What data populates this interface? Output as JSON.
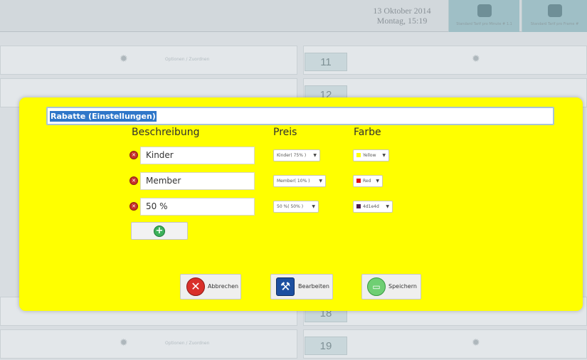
{
  "background": {
    "date": "13 Oktober 2014",
    "weekday_time": "Montag, 15:19",
    "tile_labels": [
      "Standard Tarif pro Minute # 1.1",
      "Standard Tarif pro Frame #"
    ],
    "rows": [
      {
        "option_label": "Optionen / Zuordnen",
        "right_number": "11"
      },
      {
        "option_label": "",
        "right_number": "12"
      },
      {
        "option_label": "",
        "right_number": "18"
      },
      {
        "option_label": "Optionen / Zuordnen",
        "right_number": "19"
      }
    ]
  },
  "dialog": {
    "title": "Rabatte (Einstellungen)",
    "headers": {
      "description": "Beschreibung",
      "price": "Preis",
      "color": "Farbe"
    },
    "items": [
      {
        "description": "Kinder",
        "price": "Kinder( 75% )",
        "color_name": "Yellow",
        "color_hex": "#ffff00"
      },
      {
        "description": "Member",
        "price": "Member( 10% )",
        "color_name": "Red",
        "color_hex": "#e01010"
      },
      {
        "description": "50 %",
        "price": "50 %( 50% )",
        "color_name": "4d1e4d",
        "color_hex": "#4d1e4d"
      }
    ],
    "buttons": {
      "cancel": "Abbrechen",
      "edit": "Bearbeiten",
      "save": "Speichern"
    }
  },
  "colors": {
    "dialog_bg": "#ffff00",
    "title_selection": "#2f77c9"
  },
  "icons": {
    "delete": "delete-icon",
    "add": "add-icon",
    "cancel": "cancel-icon",
    "edit": "tools-icon",
    "save": "save-icon",
    "settings": "gear-icon"
  }
}
